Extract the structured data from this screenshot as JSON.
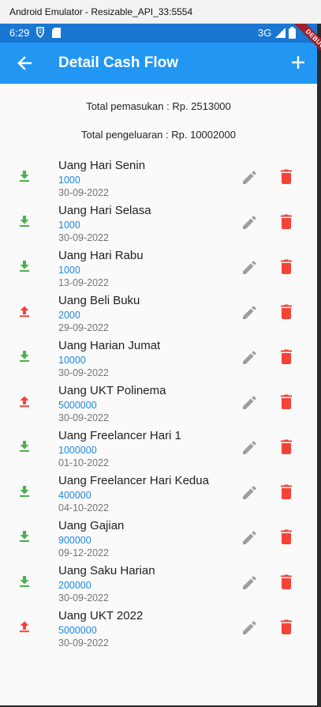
{
  "window": {
    "title": "Android Emulator - Resizable_API_33:5554"
  },
  "status_bar": {
    "time": "6:29",
    "network": "3G"
  },
  "debug_banner": "DEBUG",
  "app_bar": {
    "title": "Detail Cash Flow"
  },
  "summary": {
    "income": "Total pemasukan : Rp. 2513000",
    "expense": "Total pengeluaran : Rp. 10002000"
  },
  "colors": {
    "primary": "#2196f3",
    "status_bar": "#1976d2",
    "income": "#4caf50",
    "expense": "#f44336",
    "amount": "#1e88e5",
    "edit": "#9e9e9e"
  },
  "items": [
    {
      "type": "income",
      "name": "Uang Hari Senin",
      "amount": "1000",
      "date": "30-09-2022"
    },
    {
      "type": "income",
      "name": "Uang Hari Selasa",
      "amount": "1000",
      "date": "30-09-2022"
    },
    {
      "type": "income",
      "name": "Uang Hari Rabu",
      "amount": "1000",
      "date": "13-09-2022"
    },
    {
      "type": "expense",
      "name": "Uang Beli Buku",
      "amount": "2000",
      "date": "29-09-2022"
    },
    {
      "type": "income",
      "name": "Uang Harian Jumat",
      "amount": "10000",
      "date": "30-09-2022"
    },
    {
      "type": "expense",
      "name": "Uang UKT Polinema",
      "amount": "5000000",
      "date": "30-09-2022"
    },
    {
      "type": "income",
      "name": "Uang Freelancer Hari 1",
      "amount": "1000000",
      "date": "01-10-2022"
    },
    {
      "type": "income",
      "name": "Uang Freelancer Hari Kedua",
      "amount": "400000",
      "date": "04-10-2022"
    },
    {
      "type": "income",
      "name": "Uang Gajian",
      "amount": "900000",
      "date": "09-12-2022"
    },
    {
      "type": "income",
      "name": "Uang Saku Harian",
      "amount": "200000",
      "date": "30-09-2022"
    },
    {
      "type": "expense",
      "name": "Uang UKT 2022",
      "amount": "5000000",
      "date": "30-09-2022"
    }
  ]
}
